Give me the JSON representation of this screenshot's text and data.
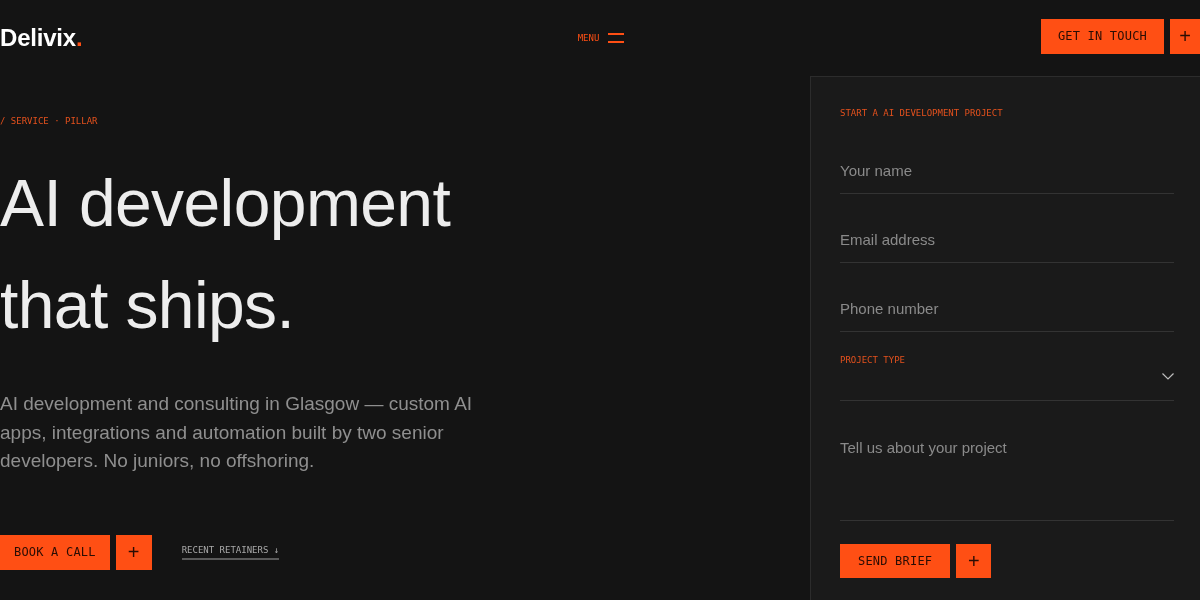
{
  "header": {
    "logo": {
      "text": "Delivix",
      "dot": "."
    },
    "menu": {
      "label": "MENU"
    },
    "cta": {
      "label": "GET IN TOUCH",
      "plus": "+"
    }
  },
  "hero": {
    "breadcrumb": "/ SERVICE · PILLAR",
    "headline_lines": [
      "AI development",
      "that ships."
    ],
    "lead": "AI development and consulting in Glasgow — custom AI apps, integrations and automation built by two senior developers. No juniors, no offshoring.",
    "actions": {
      "primary": "BOOK A CALL",
      "plus": "+",
      "link": "RECENT RETAINERS ↓"
    }
  },
  "form": {
    "title": "START A AI DEVELOPMENT PROJECT",
    "fields": [
      {
        "kind": "text",
        "placeholder": "Your name"
      },
      {
        "kind": "text",
        "placeholder": "Email address"
      },
      {
        "kind": "text",
        "placeholder": "Phone number"
      },
      {
        "kind": "select",
        "label": "PROJECT TYPE"
      },
      {
        "kind": "textarea",
        "placeholder": "Tell us about your project"
      }
    ],
    "submit": "SEND BRIEF",
    "submit_plus": "+"
  }
}
